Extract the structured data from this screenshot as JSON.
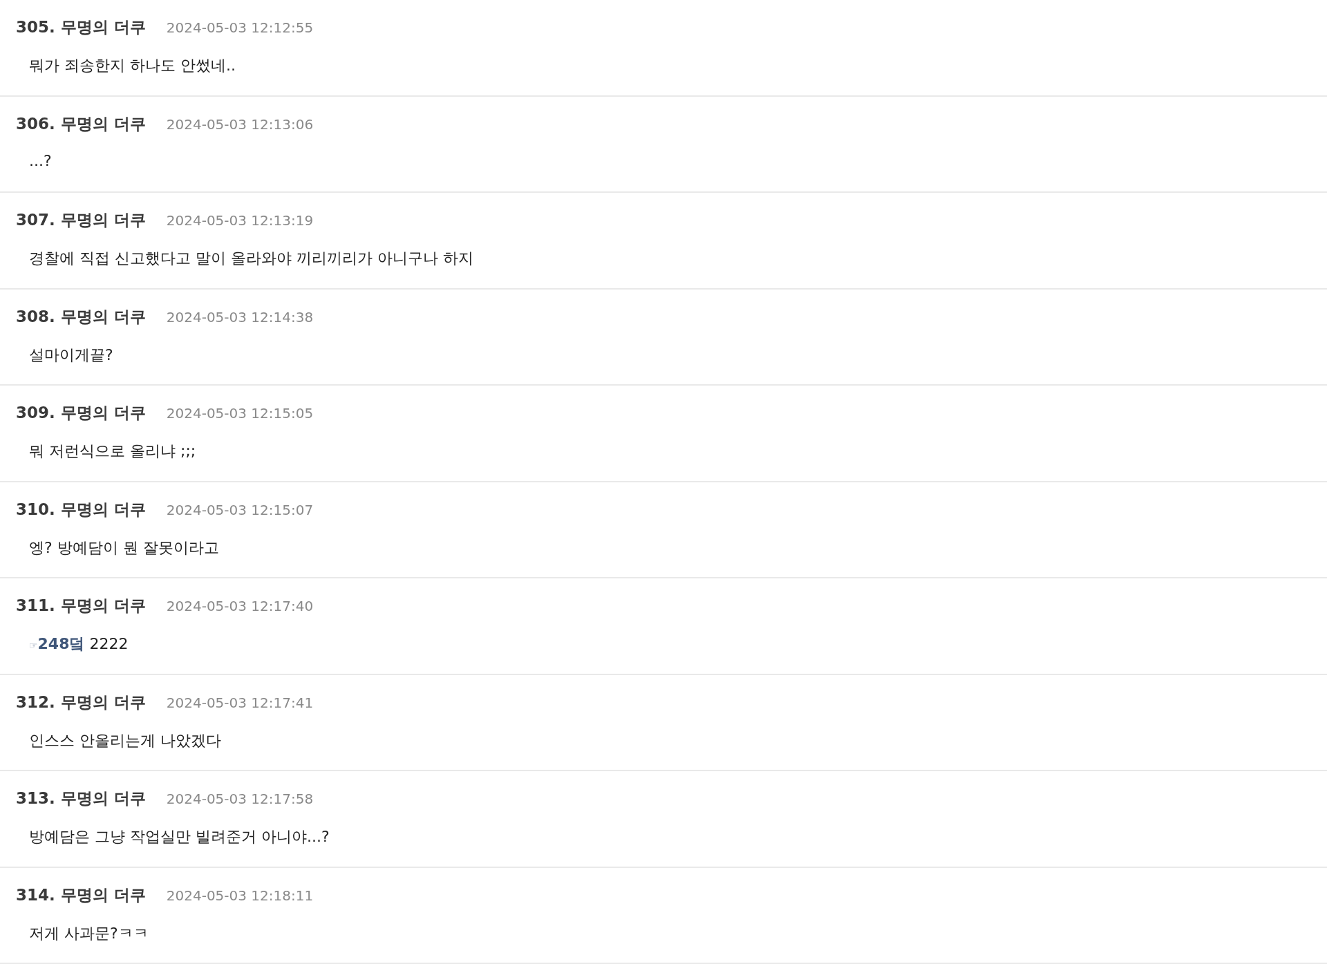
{
  "comments": [
    {
      "number": "305.",
      "author": "무명의 더쿠",
      "date": "2024-05-03 12:12:55",
      "body": [
        {
          "kind": "text",
          "text": "뭐가 죄송한지 하나도 안썼네.."
        }
      ]
    },
    {
      "number": "306.",
      "author": "무명의 더쿠",
      "date": "2024-05-03 12:13:06",
      "body": [
        {
          "kind": "text",
          "text": "...?"
        }
      ]
    },
    {
      "number": "307.",
      "author": "무명의 더쿠",
      "date": "2024-05-03 12:13:19",
      "body": [
        {
          "kind": "text",
          "text": "경찰에 직접 신고했다고 말이 올라와야 끼리끼리가 아니구나 하지"
        }
      ]
    },
    {
      "number": "308.",
      "author": "무명의 더쿠",
      "date": "2024-05-03 12:14:38",
      "body": [
        {
          "kind": "text",
          "text": "설마이게끝?"
        }
      ]
    },
    {
      "number": "309.",
      "author": "무명의 더쿠",
      "date": "2024-05-03 12:15:05",
      "body": [
        {
          "kind": "text",
          "text": "뭐 저런식으로 올리냐 ;;;"
        }
      ]
    },
    {
      "number": "310.",
      "author": "무명의 더쿠",
      "date": "2024-05-03 12:15:07",
      "body": [
        {
          "kind": "text",
          "text": "엥? 방예담이 뭔 잘못이라고"
        }
      ]
    },
    {
      "number": "311.",
      "author": "무명의 더쿠",
      "date": "2024-05-03 12:17:40",
      "body": [
        {
          "kind": "pointer",
          "text": "☞"
        },
        {
          "kind": "link",
          "text": "248덬"
        },
        {
          "kind": "text",
          "text": "2222"
        }
      ]
    },
    {
      "number": "312.",
      "author": "무명의 더쿠",
      "date": "2024-05-03 12:17:41",
      "body": [
        {
          "kind": "text",
          "text": "인스스 안올리는게 나았겠다"
        }
      ]
    },
    {
      "number": "313.",
      "author": "무명의 더쿠",
      "date": "2024-05-03 12:17:58",
      "body": [
        {
          "kind": "text",
          "text": "방예담은 그냥 작업실만 빌려준거 아니야...?"
        }
      ]
    },
    {
      "number": "314.",
      "author": "무명의 더쿠",
      "date": "2024-05-03 12:18:11",
      "body": [
        {
          "kind": "text",
          "text": "저게 사과문?ㅋㅋ"
        }
      ]
    }
  ]
}
